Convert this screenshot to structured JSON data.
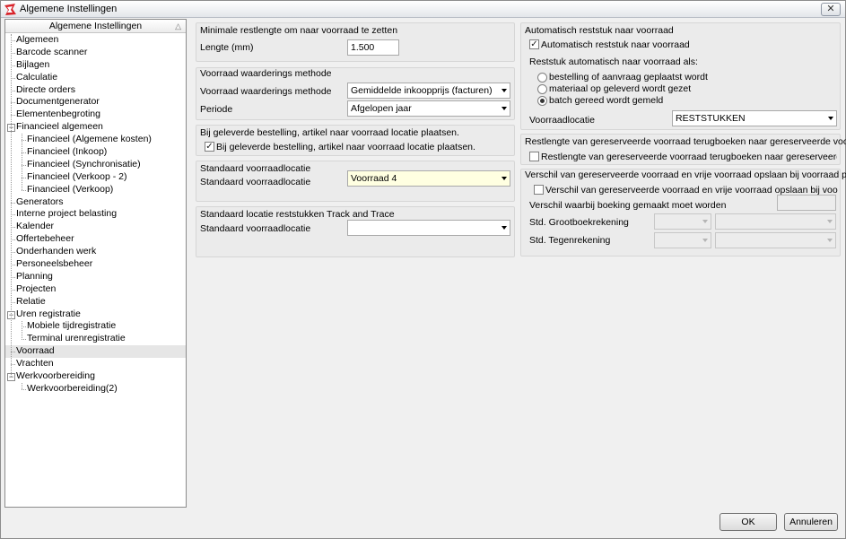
{
  "window": {
    "title": "Algemene Instellingen"
  },
  "tree": {
    "header": "Algemene Instellingen",
    "items": [
      {
        "label": "Algemeen"
      },
      {
        "label": "Barcode scanner"
      },
      {
        "label": "Bijlagen"
      },
      {
        "label": "Calculatie"
      },
      {
        "label": "Directe orders"
      },
      {
        "label": "Documentgenerator"
      },
      {
        "label": "Elementenbegroting"
      },
      {
        "label": "Financieel algemeen"
      },
      {
        "label": "Financieel (Algemene kosten)"
      },
      {
        "label": "Financieel (Inkoop)"
      },
      {
        "label": "Financieel (Synchronisatie)"
      },
      {
        "label": "Financieel (Verkoop - 2)"
      },
      {
        "label": "Financieel (Verkoop)"
      },
      {
        "label": "Generators"
      },
      {
        "label": "Interne project belasting"
      },
      {
        "label": "Kalender"
      },
      {
        "label": "Offertebeheer"
      },
      {
        "label": "Onderhanden werk"
      },
      {
        "label": "Personeelsbeheer"
      },
      {
        "label": "Planning"
      },
      {
        "label": "Projecten"
      },
      {
        "label": "Relatie"
      },
      {
        "label": "Uren registratie"
      },
      {
        "label": "Mobiele tijdregistratie"
      },
      {
        "label": "Terminal urenregistratie"
      },
      {
        "label": "Voorraad"
      },
      {
        "label": "Vrachten"
      },
      {
        "label": "Werkvoorbereiding"
      },
      {
        "label": "Werkvoorbereiding(2)"
      }
    ]
  },
  "left": {
    "min_rest": {
      "title": "Minimale restlengte om naar voorraad te zetten",
      "label": "Lengte (mm)",
      "value": "1.500"
    },
    "waardering": {
      "title": "Voorraad waarderings methode",
      "method_label": "Voorraad waarderings methode",
      "method_value": "Gemiddelde inkoopprijs (facturen)",
      "periode_label": "Periode",
      "periode_value": "Afgelopen  jaar"
    },
    "geleverd": {
      "title": "Bij geleverde bestelling, artikel naar voorraad locatie plaatsen.",
      "checkbox_label": "Bij geleverde bestelling, artikel naar voorraad locatie plaatsen."
    },
    "standaard": {
      "title": "Standaard voorraadlocatie",
      "label": "Standaard voorraadlocatie",
      "value": "Voorraad 4"
    },
    "track": {
      "title": "Standaard locatie reststukken Track and Trace",
      "label": "Standaard voorraadlocatie",
      "value": ""
    }
  },
  "right": {
    "auto_rest": {
      "title": "Automatisch reststuk naar voorraad",
      "checkbox_label": "Automatisch reststuk naar voorraad",
      "sub_label": "Reststuk automatisch naar voorraad als:",
      "radios": [
        "bestelling of aanvraag geplaatst wordt",
        "materiaal op geleverd wordt gezet",
        "batch gereed wordt gemeld"
      ],
      "loc_label": "Voorraadlocatie",
      "loc_value": "RESTSTUKKEN"
    },
    "terugboeken": {
      "title": "Restlengte van gereserveerde voorraad terugboeken naar gereserveerde voorraad.",
      "checkbox_label": "Restlengte van gereserveerde voorraad terugboeken naar gereserveerde voorraa"
    },
    "verschil": {
      "title": "Verschil van gereserveerde voorraad en vrije voorraad opslaan bij voorraad project",
      "checkbox_label": "Verschil van gereserveerde voorraad en vrije voorraad opslaan bij voorraad projec",
      "boeking_label": "Verschil waarbij boeking gemaakt moet worden",
      "grootboek_label": "Std. Grootboekrekening",
      "tegen_label": "Std. Tegenrekening"
    }
  },
  "buttons": {
    "ok": "OK",
    "cancel": "Annuleren"
  },
  "colors": {
    "accent_icon": "#d8232a",
    "field_highlight": "#ffffe1"
  }
}
